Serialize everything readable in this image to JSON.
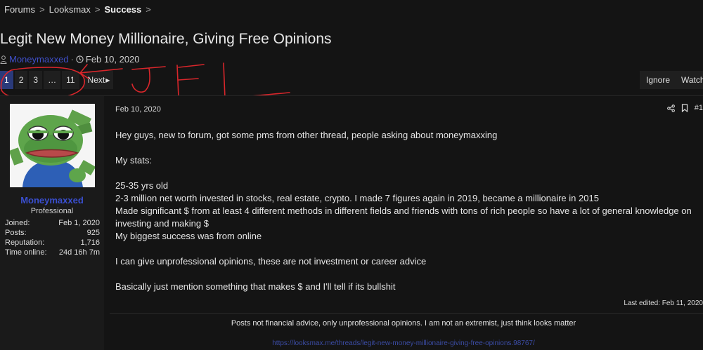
{
  "breadcrumb": {
    "items": [
      "Forums",
      "Looksmax"
    ],
    "current": "Success",
    "sep": ">"
  },
  "thread": {
    "title": "Legit New Money Millionaire, Giving Free Opinions",
    "author": "Moneymaxxed",
    "date": "Feb 10, 2020"
  },
  "pagination": {
    "pages": [
      "1",
      "2",
      "3",
      "…",
      "11"
    ],
    "current": "1",
    "next_label": "Next"
  },
  "buttons": {
    "ignore": "Ignore",
    "watch": "Watch"
  },
  "colors": {
    "accent": "#2a3a7a",
    "username": "#3a4fd0",
    "scribble": "#d8262b"
  },
  "user": {
    "name": "Moneymaxxed",
    "title": "Professional",
    "stats": [
      {
        "label": "Joined:",
        "value": "Feb 1, 2020"
      },
      {
        "label": "Posts:",
        "value": "925"
      },
      {
        "label": "Reputation:",
        "value": "1,716"
      },
      {
        "label": "Time online:",
        "value": "24d 16h 7m"
      }
    ]
  },
  "post": {
    "date": "Feb 10, 2020",
    "number": "#1",
    "lines": [
      "Hey guys, new to forum, got some pms from other thread, people asking about moneymaxxing",
      "",
      "My stats:",
      "",
      "25-35 yrs old",
      "2-3 million net worth invested in stocks, real estate, crypto. I made 7 figures again in 2019, became a millionaire in 2015",
      "Made significant $ from at least 4 different methods in different fields and friends with tons of rich people so have a lot of general knowledge on investing and making $",
      "My biggest success was from online",
      "",
      "I can give unprofessional opinions, these are not investment or career advice",
      "",
      "Basically just mention something that makes $ and I'll tell if its bullshit"
    ],
    "last_edited": "Last edited: Feb 11, 2020",
    "signature": "Posts not financial advice, only unprofessional opinions. I am not an extremist, just think looks matter",
    "watermark": "https://looksmax.me/threads/legit-new-money-millionaire-giving-free-opinions.98767/"
  },
  "icons": [
    "user-icon",
    "clock-icon",
    "share-icon",
    "bookmark-icon"
  ]
}
